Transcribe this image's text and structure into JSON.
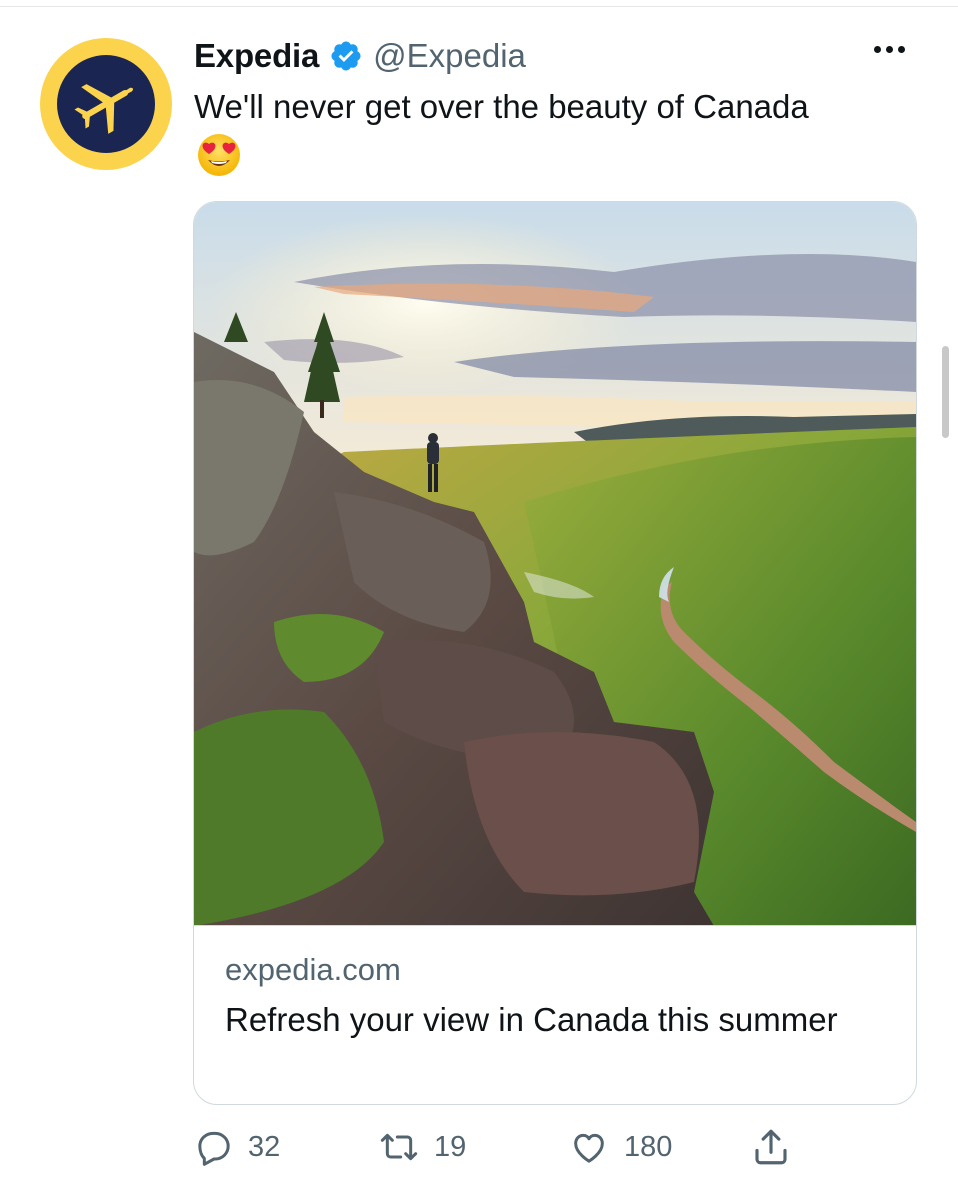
{
  "tweet": {
    "author_name": "Expedia",
    "handle": "@Expedia",
    "text": "We'll never get over the beauty of Canada",
    "emoji": "heart-eyes"
  },
  "card": {
    "domain": "expedia.com",
    "title": "Refresh your view in Canada this summer",
    "image": "hiker-on-cliff-over-canadian-valley"
  },
  "actions": {
    "reply_count": "32",
    "retweet_count": "19",
    "like_count": "180"
  },
  "colors": {
    "brand_yellow": "#fcd34d",
    "brand_navy": "#1b2551",
    "verified_blue": "#1d9bf0",
    "secondary_text": "#536471",
    "primary_text": "#0f1419"
  },
  "icons": [
    "plane-logo-icon",
    "verified-badge-icon",
    "more-icon",
    "reply-icon",
    "retweet-icon",
    "like-icon",
    "share-icon"
  ]
}
